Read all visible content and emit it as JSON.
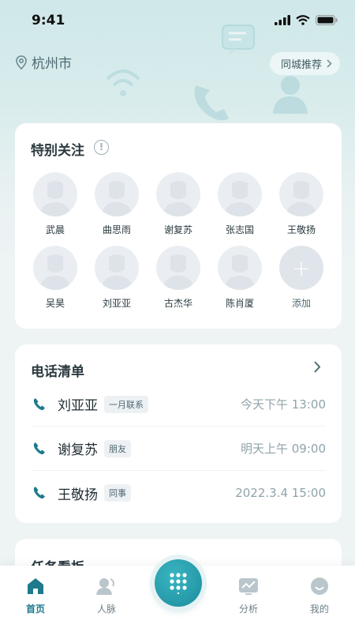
{
  "status": {
    "time": "9:41"
  },
  "location": {
    "city": "杭州市",
    "recommend_label": "同城推荐"
  },
  "favorites": {
    "title": "特别关注",
    "contacts": [
      "武晨",
      "曲思雨",
      "谢复苏",
      "张志国",
      "王敬扬",
      "吴昊",
      "刘亚亚",
      "古杰华",
      "陈肖厦"
    ],
    "add_label": "添加",
    "add_symbol": "+"
  },
  "calls": {
    "title": "电话清单",
    "items": [
      {
        "name": "刘亚亚",
        "tag": "一月联系",
        "time": "今天下午 13:00"
      },
      {
        "name": "谢复苏",
        "tag": "朋友",
        "time": "明天上午 09:00"
      },
      {
        "name": "王敬扬",
        "tag": "同事",
        "time": "2022.3.4 15:00"
      }
    ]
  },
  "tasks": {
    "title": "任务看板"
  },
  "tabbar": {
    "items": [
      {
        "label": "首页",
        "icon": "home-icon",
        "active": true
      },
      {
        "label": "人脉",
        "icon": "contacts-icon",
        "active": false
      },
      {
        "label": "分析",
        "icon": "analysis-icon",
        "active": false
      },
      {
        "label": "我的",
        "icon": "profile-icon",
        "active": false
      }
    ],
    "center_icon": "dialpad-icon"
  },
  "colors": {
    "accent": "#1e7a8c",
    "call_icon": "#1e7a8c",
    "fab": "#22a1b0"
  }
}
